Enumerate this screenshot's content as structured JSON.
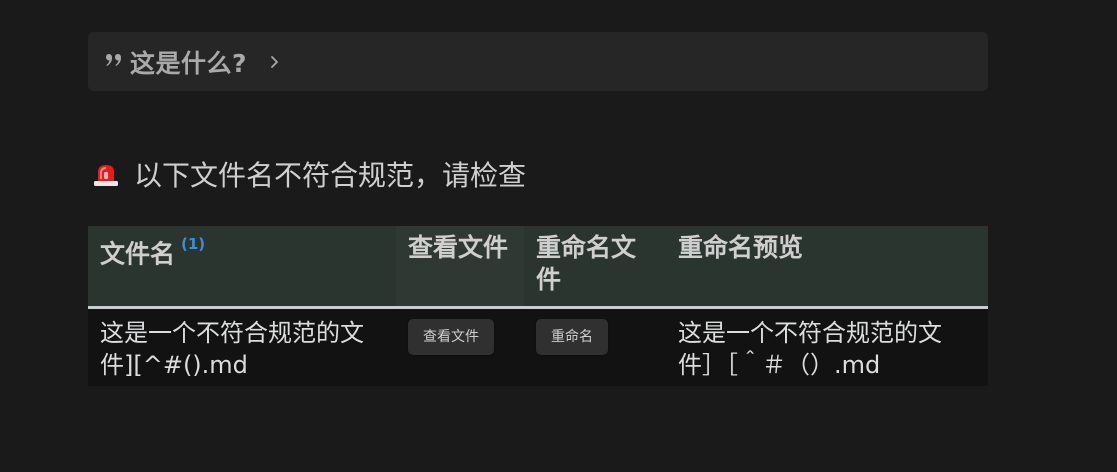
{
  "callout": {
    "title": "这是什么?",
    "icon": "quote-icon",
    "toggle_icon": "chevron-right-icon"
  },
  "heading": {
    "icon": "siren-icon",
    "text": "以下文件名不符合规范，请检查"
  },
  "table": {
    "headers": {
      "filename": "文件名",
      "footnote": "(1)",
      "view": "查看文件",
      "rename": "重命名文件",
      "preview": "重命名预览"
    },
    "rows": [
      {
        "filename": "这是一个不符合规范的文件][^#().md",
        "view_button": "查看文件",
        "rename_button": "重命名",
        "preview": "这是一个不符合规范的文件］［＾＃（）.md"
      }
    ]
  },
  "colors": {
    "background": "#1a1a1a",
    "callout_bg": "#262626",
    "header_bg": "#2b3530",
    "row_bg": "#121212",
    "accent": "#3f8fd0",
    "siren_red": "#e02020"
  }
}
